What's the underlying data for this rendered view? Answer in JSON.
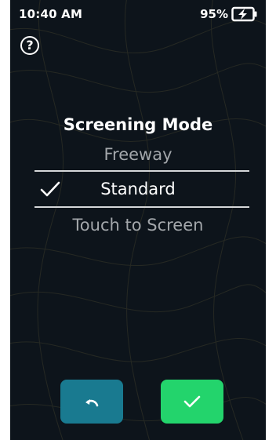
{
  "status_bar": {
    "time": "10:40 AM",
    "battery_percent": "95%",
    "battery_state": "charging",
    "battery_icon": "battery-charging-icon"
  },
  "help": {
    "label": "?",
    "icon": "help-icon"
  },
  "screening_mode": {
    "title": "Screening Mode",
    "options": [
      {
        "label": "Freeway",
        "selected": false
      },
      {
        "label": "Standard",
        "selected": true
      },
      {
        "label": "Touch to Screen",
        "selected": false
      }
    ],
    "selected_icon": "check-icon"
  },
  "actions": {
    "back_icon": "undo-arrow-icon",
    "confirm_icon": "check-icon"
  },
  "colors": {
    "background": "#0d141b",
    "back_button": "#197a90",
    "confirm_button": "#23d46c",
    "unselected_text": "#a3a7ab",
    "selected_text": "#ffffff"
  }
}
